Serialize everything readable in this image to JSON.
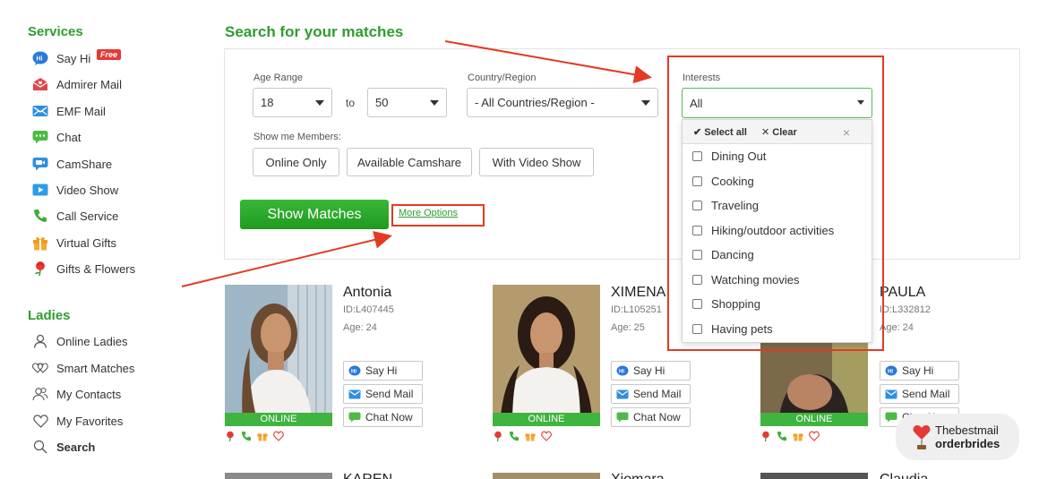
{
  "sidebar": {
    "services_title": "Services",
    "services": [
      {
        "label": "Say Hi",
        "icon": "say-hi-icon",
        "badge": "Free"
      },
      {
        "label": "Admirer Mail",
        "icon": "admirer-mail-icon"
      },
      {
        "label": "EMF Mail",
        "icon": "mail-icon"
      },
      {
        "label": "Chat",
        "icon": "chat-icon"
      },
      {
        "label": "CamShare",
        "icon": "camshare-icon"
      },
      {
        "label": "Video Show",
        "icon": "video-icon"
      },
      {
        "label": "Call Service",
        "icon": "phone-icon"
      },
      {
        "label": "Virtual Gifts",
        "icon": "gift-icon"
      },
      {
        "label": "Gifts & Flowers",
        "icon": "flower-icon"
      }
    ],
    "ladies_title": "Ladies",
    "ladies": [
      {
        "label": "Online Ladies",
        "icon": "person-icon"
      },
      {
        "label": "Smart Matches",
        "icon": "hearts-icon"
      },
      {
        "label": "My Contacts",
        "icon": "contacts-icon"
      },
      {
        "label": "My Favorites",
        "icon": "heart-icon"
      },
      {
        "label": "Search",
        "icon": "search-icon"
      }
    ]
  },
  "search": {
    "title": "Search for your matches",
    "age_label": "Age Range",
    "age_from": "18",
    "age_to_label": "to",
    "age_to": "50",
    "country_label": "Country/Region",
    "country_value": "- All Countries/Region -",
    "interests_label": "Interests",
    "interests_value": "All",
    "show_members_label": "Show me Members:",
    "member_buttons": [
      "Online Only",
      "Available Camshare",
      "With Video Show"
    ],
    "show_matches": "Show Matches",
    "more_options": "More Options"
  },
  "interests_dropdown": {
    "select_all": "Select all",
    "clear": "Clear",
    "close": "×",
    "items": [
      "Dining Out",
      "Cooking",
      "Traveling",
      "Hiking/outdoor activities",
      "Dancing",
      "Watching movies",
      "Shopping",
      "Having pets"
    ]
  },
  "profiles": [
    {
      "name": "Antonia",
      "id": "ID:L407445",
      "age": "Age: 24",
      "status": "ONLINE"
    },
    {
      "name": "XIMENA",
      "id": "ID:L105251",
      "age": "Age: 25",
      "status": "ONLINE"
    },
    {
      "name": "PAULA",
      "id": "ID:L332812",
      "age": "Age: 24",
      "status": "ONLINE"
    }
  ],
  "profile_actions": {
    "say_hi": "Say Hi",
    "send_mail": "Send Mail",
    "chat_now": "Chat Now"
  },
  "partial_names": [
    "KAREN",
    "Xiomara",
    "Claudia"
  ],
  "watermark": {
    "line1": "Thebestmail",
    "line2": "orderbrides"
  },
  "colors": {
    "accent_green": "#2e9d2e",
    "highlight_red": "#e53a22",
    "online_green": "#3fb43f"
  }
}
